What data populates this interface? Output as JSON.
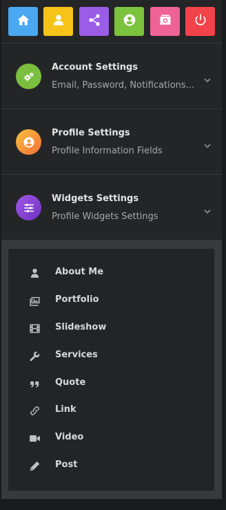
{
  "toolbar": {
    "buttons": [
      {
        "name": "home",
        "icon": "home-icon",
        "color": "#4aa8f0"
      },
      {
        "name": "user",
        "icon": "user-icon",
        "color": "#f6c319"
      },
      {
        "name": "share",
        "icon": "share-icon",
        "color": "#9b5ce8"
      },
      {
        "name": "profile",
        "icon": "user-circle-icon",
        "color": "#7bc23d"
      },
      {
        "name": "camera",
        "icon": "camera-icon",
        "color": "#ef6295"
      },
      {
        "name": "power",
        "icon": "power-icon",
        "color": "#f2434b"
      }
    ]
  },
  "sections": [
    {
      "title": "Account Settings",
      "subtitle": "Email, Password, Notifications...",
      "icon": "cogs-icon",
      "color": "#7cbf3f"
    },
    {
      "title": "Profile Settings",
      "subtitle": "Profile Information Fields",
      "icon": "user-circle-icon",
      "color": "#f7a234"
    },
    {
      "title": "Widgets Settings",
      "subtitle": "Profile Widgets Settings",
      "icon": "sliders-icon",
      "color": "#8c43d6"
    }
  ],
  "widgets_menu": {
    "items": [
      {
        "label": "About Me",
        "icon": "user-icon"
      },
      {
        "label": "Portfolio",
        "icon": "images-icon"
      },
      {
        "label": "Slideshow",
        "icon": "film-icon"
      },
      {
        "label": "Services",
        "icon": "wrench-icon"
      },
      {
        "label": "Quote",
        "icon": "quote-icon"
      },
      {
        "label": "Link",
        "icon": "link-icon"
      },
      {
        "label": "Video",
        "icon": "video-icon"
      },
      {
        "label": "Post",
        "icon": "pencil-icon"
      }
    ]
  }
}
